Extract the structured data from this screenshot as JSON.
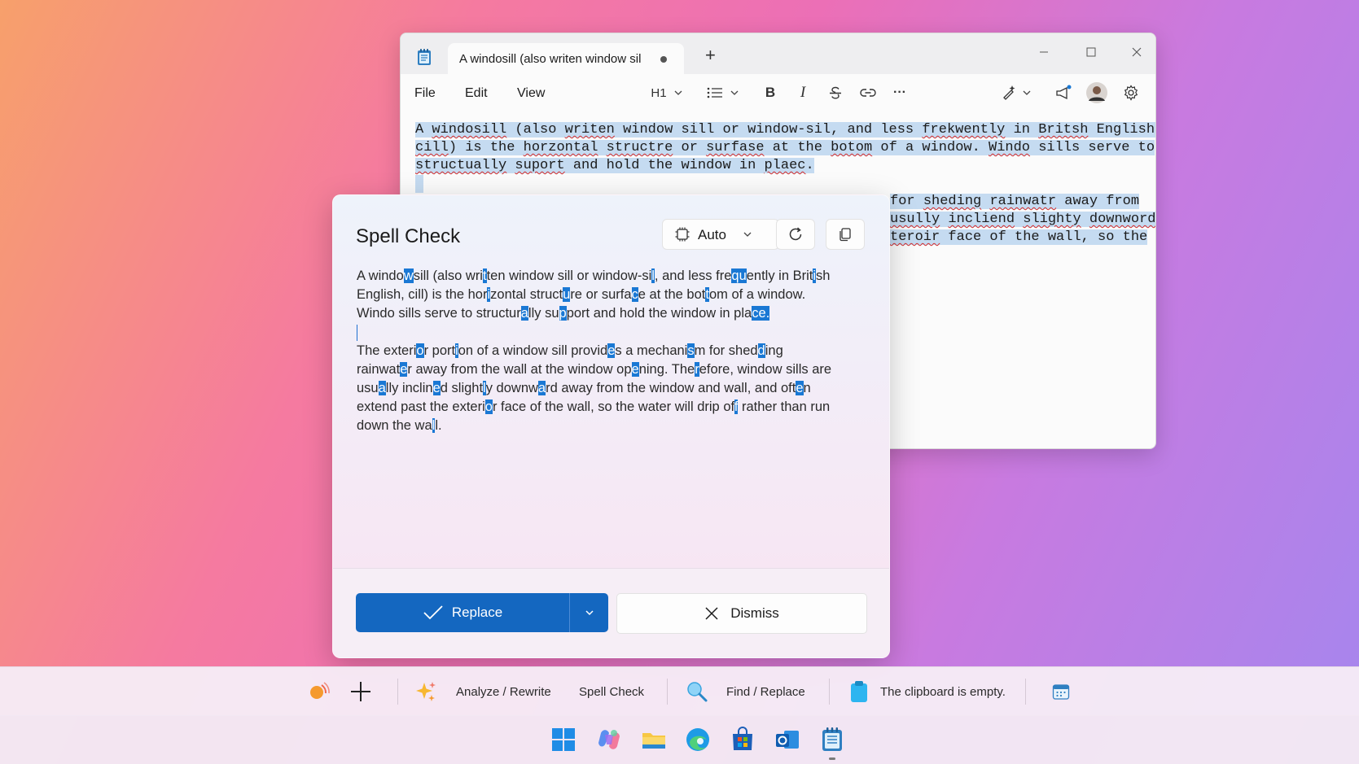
{
  "notepad": {
    "tab_title": "A windosill (also writen window sil",
    "new_tab": "+",
    "menu": {
      "file": "File",
      "edit": "Edit",
      "view": "View"
    },
    "toolbar": {
      "heading": "H1",
      "bold": "B",
      "italic": "I",
      "more": "···"
    },
    "content": {
      "line1_a": "A ",
      "line1_e1": "windosill",
      "line1_b": " (also ",
      "line1_e2": "writen",
      "line1_c": " window sill or window-sil, and less ",
      "line1_e3": "frekwently",
      "line1_d": " in ",
      "line1_e4": "Britsh",
      "line1_f": " English,",
      "line2_e1": "cill",
      "line2_a": ") is the ",
      "line2_e2": "horzontal",
      "line2_b": " ",
      "line2_e3": "structre",
      "line2_c": " or ",
      "line2_e4": "surfase",
      "line2_d": " at the ",
      "line2_e5": "botom",
      "line2_f": " of a window. ",
      "line2_e6": "Windo",
      "line2_g": " sills serve to",
      "line3_e1": "structually",
      "line3_a": " ",
      "line3_e2": "suport",
      "line3_b": " and hold the window in ",
      "line3_e3": "plaec",
      "line3_c": ".",
      "line5_a": "for ",
      "line5_e1": "sheding",
      "line5_b": " ",
      "line5_e2": "rainwatr",
      "line5_c": " away from",
      "line6_e1": "usully",
      "line6_a": " ",
      "line6_e2": "incliend",
      "line6_b": " ",
      "line6_e3": "slighty",
      "line6_c": " ",
      "line6_e4": "downword",
      "line7_e1": "teroir",
      "line7_a": " face of the wall, so the"
    }
  },
  "spellcheck": {
    "title": "Spell Check",
    "mode_label": "Auto",
    "replace_label": "Replace",
    "dismiss_label": "Dismiss",
    "p1": {
      "l1": [
        "A windo",
        "w",
        "sill (also wri",
        "t",
        "ten window sill or window-si",
        "l",
        ", and less fre",
        "qu",
        "ently in Brit",
        "i",
        "sh"
      ],
      "l2": [
        "English, cill) is the hor",
        "i",
        "zontal struct",
        "u",
        "re or surfa",
        "c",
        "e at the bot",
        "t",
        "om of a window."
      ],
      "l3": [
        "Windo sills serve to structur",
        "a",
        "lly su",
        "p",
        "port and hold the window in pla",
        "ce."
      ]
    },
    "p2": {
      "l1": [
        "The exteri",
        "o",
        "r port",
        "i",
        "on of a window sill provid",
        "e",
        "s a mechani",
        "s",
        "m for shed",
        "d",
        "ing"
      ],
      "l2": [
        "rainwat",
        "e",
        "r away from the wall at the window op",
        "e",
        "ning. The",
        "r",
        "efore, window sills are"
      ],
      "l3": [
        "usu",
        "a",
        "lly inclin",
        "e",
        "d slight",
        "l",
        "y downw",
        "a",
        "rd away from the window and wall, and oft",
        "e",
        "n"
      ],
      "l4": [
        "extend past the exteri",
        "o",
        "r face of the wall, so the water will drip of",
        "f",
        " rather than run"
      ],
      "l5": [
        "down the wa",
        "l",
        "l."
      ]
    }
  },
  "bottom_bar": {
    "analyze": "Analyze / Rewrite",
    "spell": "Spell Check",
    "find": "Find / Replace",
    "clipboard": "The clipboard is empty."
  },
  "colors": {
    "accent": "#1467c0",
    "selection": "#c5dbf1",
    "error_underline": "#d42a2a",
    "correction_mark": "#1a78d4"
  }
}
